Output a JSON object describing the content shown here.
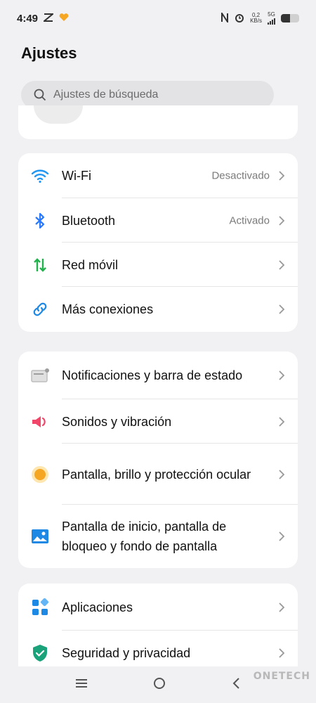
{
  "status_bar": {
    "time": "4:49",
    "speed_value": "0,2",
    "speed_unit": "KB/s",
    "network": "5G"
  },
  "header": {
    "title": "Ajustes"
  },
  "search": {
    "placeholder": "Ajustes de búsqueda"
  },
  "group_connections": [
    {
      "label": "Wi-Fi",
      "value": "Desactivado",
      "icon": "wifi-icon",
      "color": "#2196f3"
    },
    {
      "label": "Bluetooth",
      "value": "Activado",
      "icon": "bluetooth-icon",
      "color": "#2979ff"
    },
    {
      "label": "Red móvil",
      "value": "",
      "icon": "mobile-network-icon",
      "color": "#22b14c"
    },
    {
      "label": "Más conexiones",
      "value": "",
      "icon": "link-icon",
      "color": "#1e88e5"
    }
  ],
  "group_display": [
    {
      "label": "Notificaciones y barra de estado",
      "icon": "notification-bar-icon",
      "color": "#9e9e9e"
    },
    {
      "label": "Sonidos y vibración",
      "icon": "sound-icon",
      "color": "#f0466a"
    },
    {
      "label": "Pantalla, brillo y protección ocular",
      "icon": "brightness-icon",
      "color": "#f5a623"
    },
    {
      "label": "Pantalla de inicio, pantalla de bloqueo y fondo de pantalla",
      "icon": "wallpaper-icon",
      "color": "#1e88e5"
    }
  ],
  "group_apps": [
    {
      "label": "Aplicaciones",
      "icon": "apps-icon",
      "color": "#1e88e5"
    },
    {
      "label": "Seguridad y privacidad",
      "icon": "shield-icon",
      "color": "#1aa37a"
    }
  ],
  "watermark": "ONETECH"
}
